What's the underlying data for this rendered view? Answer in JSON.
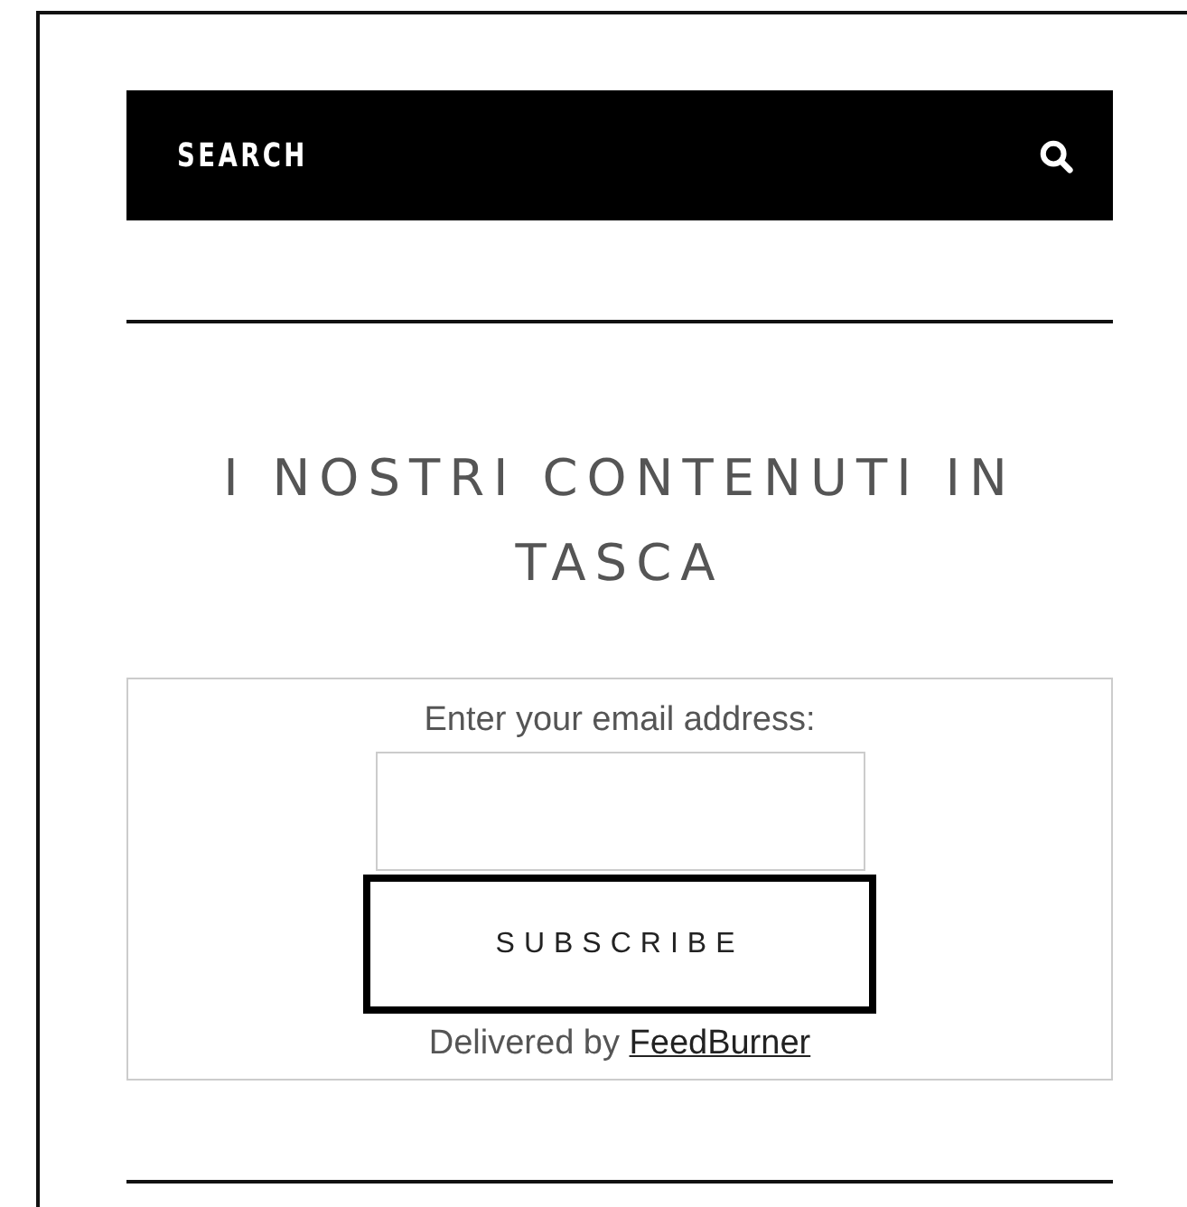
{
  "search": {
    "label": "SEARCH"
  },
  "widget": {
    "title": "I NOSTRI CONTENUTI IN TASCA",
    "prompt": "Enter your email address:",
    "button": "SUBSCRIBE",
    "delivered_text": "Delivered by",
    "delivered_link": "FeedBurner"
  }
}
